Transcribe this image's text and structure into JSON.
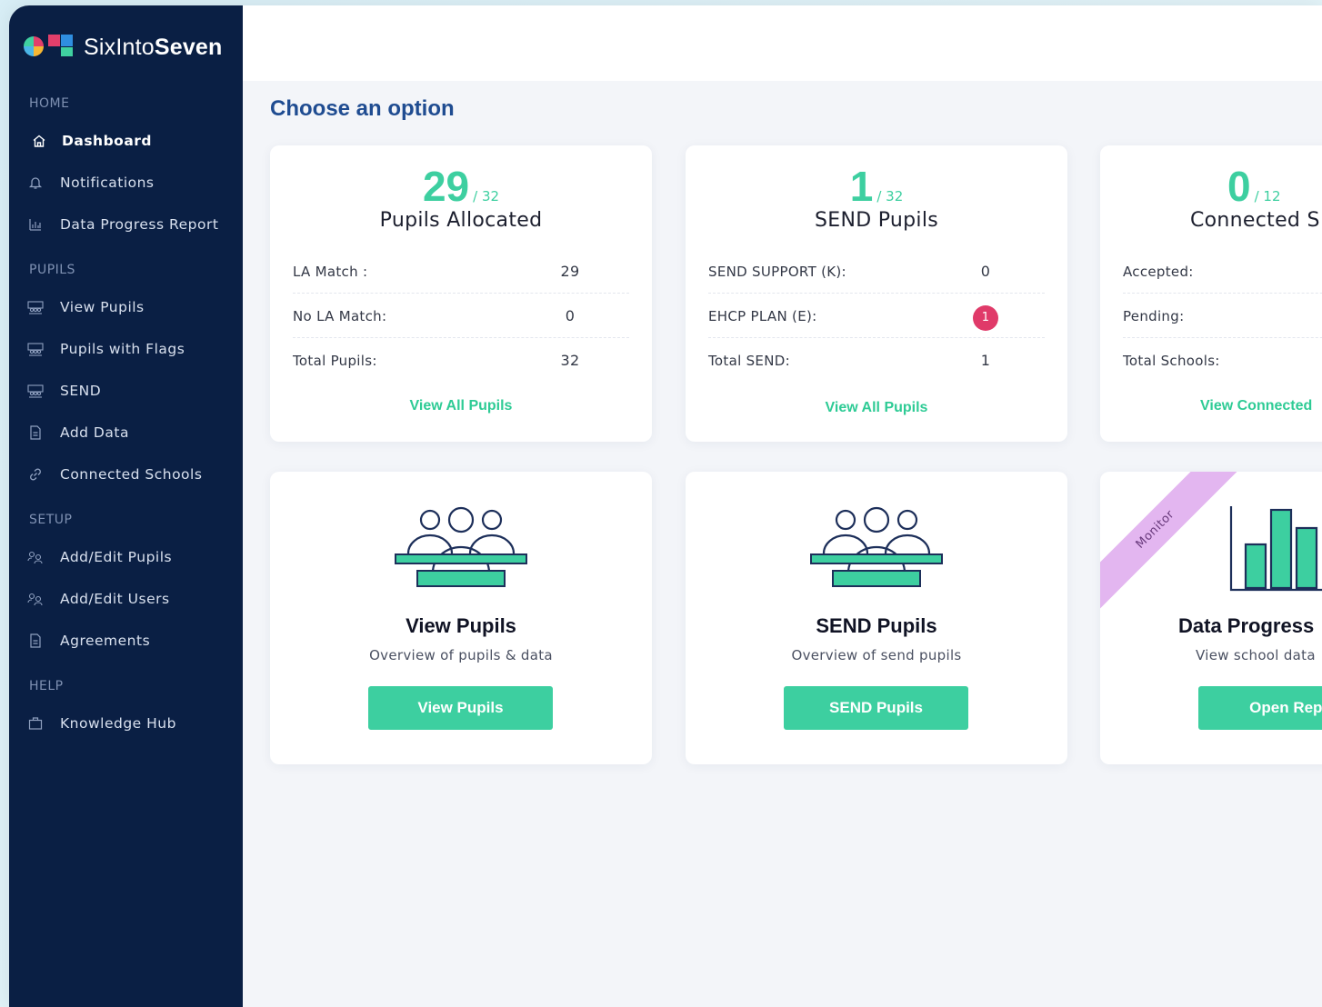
{
  "brand": {
    "name_light": "SixInto",
    "name_bold": "Seven"
  },
  "sidebar": {
    "sections": {
      "home": "HOME",
      "pupils": "PUPILS",
      "setup": "SETUP",
      "help": "HELP"
    },
    "items": {
      "dashboard": "Dashboard",
      "notifications": "Notifications",
      "data_progress_report": "Data Progress Report",
      "view_pupils": "View Pupils",
      "pupils_with_flags": "Pupils with Flags",
      "send": "SEND",
      "add_data": "Add Data",
      "connected_schools": "Connected Schools",
      "add_edit_pupils": "Add/Edit Pupils",
      "add_edit_users": "Add/Edit Users",
      "agreements": "Agreements",
      "knowledge_hub": "Knowledge Hub"
    }
  },
  "main": {
    "title": "Choose an option",
    "stat_cards": [
      {
        "value": "29",
        "of": "/ 32",
        "title": "Pupils Allocated",
        "rows": [
          {
            "label": "LA Match :",
            "value": "29"
          },
          {
            "label": "No LA Match:",
            "value": "0"
          },
          {
            "label": "Total Pupils:",
            "value": "32"
          }
        ],
        "link": "View All Pupils"
      },
      {
        "value": "1",
        "of": "/ 32",
        "title": "SEND Pupils",
        "rows": [
          {
            "label": "SEND SUPPORT (K):",
            "value": "0"
          },
          {
            "label": "EHCP PLAN (E):",
            "value": "1"
          },
          {
            "label": "Total SEND:",
            "value": "1"
          }
        ],
        "link": "View All Pupils"
      },
      {
        "value": "0",
        "of": "/ 12",
        "title": "Connected S",
        "rows": [
          {
            "label": "Accepted:",
            "value": ""
          },
          {
            "label": "Pending:",
            "value": ""
          },
          {
            "label": "Total Schools:",
            "value": ""
          }
        ],
        "link": "View Connected"
      }
    ],
    "feature_cards": [
      {
        "title": "View Pupils",
        "subtitle": "Overview of pupils & data",
        "button": "View Pupils",
        "icon": "group-icon"
      },
      {
        "title": "SEND Pupils",
        "subtitle": "Overview of send pupils",
        "button": "SEND Pupils",
        "icon": "group-icon"
      },
      {
        "title": "Data Progress",
        "subtitle": "View school data",
        "button": "Open Repo",
        "icon": "bar-chart-icon",
        "ribbon": "Monitor"
      }
    ]
  },
  "colors": {
    "sidebar": "#0a1f44",
    "accent": "#3dcfa0",
    "title": "#1f4c91",
    "badge": "#e03a69"
  }
}
